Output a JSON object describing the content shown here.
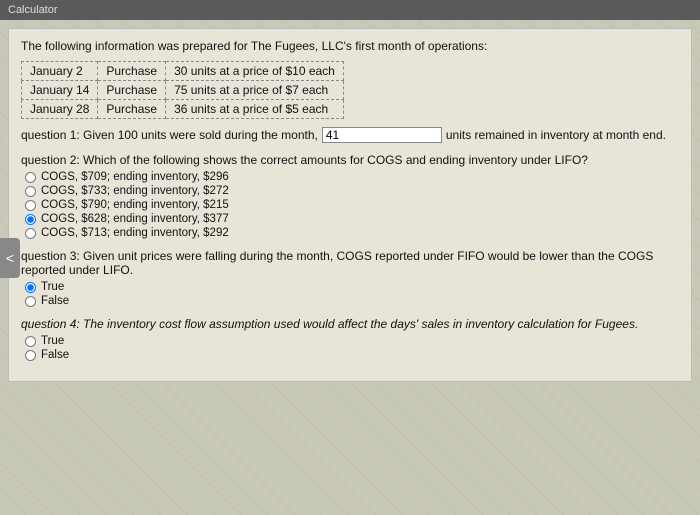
{
  "topBar": {
    "title": "Calculator"
  },
  "intro": {
    "text": "The following information was prepared for The Fugees, LLC's first month of operations:"
  },
  "inventoryTable": {
    "rows": [
      {
        "date": "January 2",
        "action": "Purchase",
        "description": "30 units at a price of $10 each"
      },
      {
        "date": "January 14",
        "action": "Purchase",
        "description": "75 units at a price of $7 each"
      },
      {
        "date": "January 28",
        "action": "Purchase",
        "description": "36 units at a price of $5 each"
      }
    ]
  },
  "question1": {
    "label": "question 1: Given 100 units were sold during the month,",
    "inputValue": "41",
    "suffix": "units remained in inventory at month end."
  },
  "question2": {
    "label": "question 2: Which of the following shows the correct amounts for COGS and ending inventory under LIFO?",
    "options": [
      {
        "id": "q2a",
        "text": "COGS, $709; ending inventory, $296",
        "selected": false
      },
      {
        "id": "q2b",
        "text": "COGS, $733; ending inventory, $272",
        "selected": false
      },
      {
        "id": "q2c",
        "text": "COGS, $790; ending inventory, $215",
        "selected": false
      },
      {
        "id": "q2d",
        "text": "COGS, $628; ending inventory, $377",
        "selected": true
      },
      {
        "id": "q2e",
        "text": "COGS, $713; ending inventory, $292",
        "selected": false
      }
    ]
  },
  "question3": {
    "label": "question 3: Given unit prices were falling during the month, COGS reported under FIFO would be lower than the COGS reported under LIFO.",
    "options": [
      {
        "id": "q3t",
        "text": "True",
        "selected": true
      },
      {
        "id": "q3f",
        "text": "False",
        "selected": false
      }
    ]
  },
  "question4": {
    "label": "question 4: The inventory cost flow assumption used would affect the days' sales in inventory calculation for Fugees.",
    "options": [
      {
        "id": "q4t",
        "text": "True",
        "selected": false
      },
      {
        "id": "q4f",
        "text": "False",
        "selected": false
      }
    ]
  },
  "navArrow": {
    "symbol": "<"
  }
}
